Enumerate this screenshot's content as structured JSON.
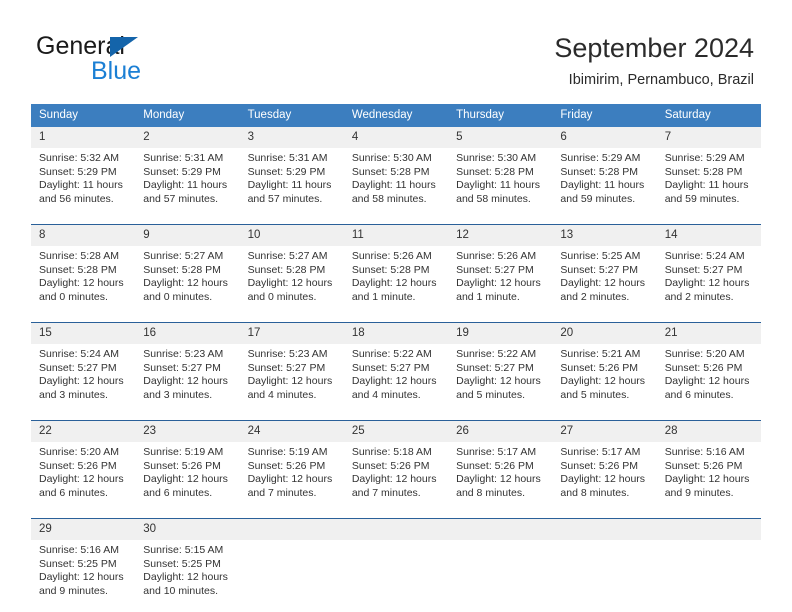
{
  "brand": {
    "name_top": "General",
    "name_bottom": "Blue",
    "triangle_color": "#1464aa",
    "blue_color": "#1b7fd4"
  },
  "header": {
    "title": "September 2024",
    "subtitle": "Ibimirim, Pernambuco, Brazil"
  },
  "theme": {
    "header_bg": "#3c7ebf",
    "header_text": "#ffffff",
    "daynum_bg": "#f0f0f0",
    "separator": "#2a6099",
    "body_text": "#333333"
  },
  "calendar": {
    "weekdays": [
      "Sunday",
      "Monday",
      "Tuesday",
      "Wednesday",
      "Thursday",
      "Friday",
      "Saturday"
    ],
    "weeks": [
      [
        {
          "day": "1",
          "sunrise": "Sunrise: 5:32 AM",
          "sunset": "Sunset: 5:29 PM",
          "daylight1": "Daylight: 11 hours",
          "daylight2": "and 56 minutes."
        },
        {
          "day": "2",
          "sunrise": "Sunrise: 5:31 AM",
          "sunset": "Sunset: 5:29 PM",
          "daylight1": "Daylight: 11 hours",
          "daylight2": "and 57 minutes."
        },
        {
          "day": "3",
          "sunrise": "Sunrise: 5:31 AM",
          "sunset": "Sunset: 5:29 PM",
          "daylight1": "Daylight: 11 hours",
          "daylight2": "and 57 minutes."
        },
        {
          "day": "4",
          "sunrise": "Sunrise: 5:30 AM",
          "sunset": "Sunset: 5:28 PM",
          "daylight1": "Daylight: 11 hours",
          "daylight2": "and 58 minutes."
        },
        {
          "day": "5",
          "sunrise": "Sunrise: 5:30 AM",
          "sunset": "Sunset: 5:28 PM",
          "daylight1": "Daylight: 11 hours",
          "daylight2": "and 58 minutes."
        },
        {
          "day": "6",
          "sunrise": "Sunrise: 5:29 AM",
          "sunset": "Sunset: 5:28 PM",
          "daylight1": "Daylight: 11 hours",
          "daylight2": "and 59 minutes."
        },
        {
          "day": "7",
          "sunrise": "Sunrise: 5:29 AM",
          "sunset": "Sunset: 5:28 PM",
          "daylight1": "Daylight: 11 hours",
          "daylight2": "and 59 minutes."
        }
      ],
      [
        {
          "day": "8",
          "sunrise": "Sunrise: 5:28 AM",
          "sunset": "Sunset: 5:28 PM",
          "daylight1": "Daylight: 12 hours",
          "daylight2": "and 0 minutes."
        },
        {
          "day": "9",
          "sunrise": "Sunrise: 5:27 AM",
          "sunset": "Sunset: 5:28 PM",
          "daylight1": "Daylight: 12 hours",
          "daylight2": "and 0 minutes."
        },
        {
          "day": "10",
          "sunrise": "Sunrise: 5:27 AM",
          "sunset": "Sunset: 5:28 PM",
          "daylight1": "Daylight: 12 hours",
          "daylight2": "and 0 minutes."
        },
        {
          "day": "11",
          "sunrise": "Sunrise: 5:26 AM",
          "sunset": "Sunset: 5:28 PM",
          "daylight1": "Daylight: 12 hours",
          "daylight2": "and 1 minute."
        },
        {
          "day": "12",
          "sunrise": "Sunrise: 5:26 AM",
          "sunset": "Sunset: 5:27 PM",
          "daylight1": "Daylight: 12 hours",
          "daylight2": "and 1 minute."
        },
        {
          "day": "13",
          "sunrise": "Sunrise: 5:25 AM",
          "sunset": "Sunset: 5:27 PM",
          "daylight1": "Daylight: 12 hours",
          "daylight2": "and 2 minutes."
        },
        {
          "day": "14",
          "sunrise": "Sunrise: 5:24 AM",
          "sunset": "Sunset: 5:27 PM",
          "daylight1": "Daylight: 12 hours",
          "daylight2": "and 2 minutes."
        }
      ],
      [
        {
          "day": "15",
          "sunrise": "Sunrise: 5:24 AM",
          "sunset": "Sunset: 5:27 PM",
          "daylight1": "Daylight: 12 hours",
          "daylight2": "and 3 minutes."
        },
        {
          "day": "16",
          "sunrise": "Sunrise: 5:23 AM",
          "sunset": "Sunset: 5:27 PM",
          "daylight1": "Daylight: 12 hours",
          "daylight2": "and 3 minutes."
        },
        {
          "day": "17",
          "sunrise": "Sunrise: 5:23 AM",
          "sunset": "Sunset: 5:27 PM",
          "daylight1": "Daylight: 12 hours",
          "daylight2": "and 4 minutes."
        },
        {
          "day": "18",
          "sunrise": "Sunrise: 5:22 AM",
          "sunset": "Sunset: 5:27 PM",
          "daylight1": "Daylight: 12 hours",
          "daylight2": "and 4 minutes."
        },
        {
          "day": "19",
          "sunrise": "Sunrise: 5:22 AM",
          "sunset": "Sunset: 5:27 PM",
          "daylight1": "Daylight: 12 hours",
          "daylight2": "and 5 minutes."
        },
        {
          "day": "20",
          "sunrise": "Sunrise: 5:21 AM",
          "sunset": "Sunset: 5:26 PM",
          "daylight1": "Daylight: 12 hours",
          "daylight2": "and 5 minutes."
        },
        {
          "day": "21",
          "sunrise": "Sunrise: 5:20 AM",
          "sunset": "Sunset: 5:26 PM",
          "daylight1": "Daylight: 12 hours",
          "daylight2": "and 6 minutes."
        }
      ],
      [
        {
          "day": "22",
          "sunrise": "Sunrise: 5:20 AM",
          "sunset": "Sunset: 5:26 PM",
          "daylight1": "Daylight: 12 hours",
          "daylight2": "and 6 minutes."
        },
        {
          "day": "23",
          "sunrise": "Sunrise: 5:19 AM",
          "sunset": "Sunset: 5:26 PM",
          "daylight1": "Daylight: 12 hours",
          "daylight2": "and 6 minutes."
        },
        {
          "day": "24",
          "sunrise": "Sunrise: 5:19 AM",
          "sunset": "Sunset: 5:26 PM",
          "daylight1": "Daylight: 12 hours",
          "daylight2": "and 7 minutes."
        },
        {
          "day": "25",
          "sunrise": "Sunrise: 5:18 AM",
          "sunset": "Sunset: 5:26 PM",
          "daylight1": "Daylight: 12 hours",
          "daylight2": "and 7 minutes."
        },
        {
          "day": "26",
          "sunrise": "Sunrise: 5:17 AM",
          "sunset": "Sunset: 5:26 PM",
          "daylight1": "Daylight: 12 hours",
          "daylight2": "and 8 minutes."
        },
        {
          "day": "27",
          "sunrise": "Sunrise: 5:17 AM",
          "sunset": "Sunset: 5:26 PM",
          "daylight1": "Daylight: 12 hours",
          "daylight2": "and 8 minutes."
        },
        {
          "day": "28",
          "sunrise": "Sunrise: 5:16 AM",
          "sunset": "Sunset: 5:26 PM",
          "daylight1": "Daylight: 12 hours",
          "daylight2": "and 9 minutes."
        }
      ],
      [
        {
          "day": "29",
          "sunrise": "Sunrise: 5:16 AM",
          "sunset": "Sunset: 5:25 PM",
          "daylight1": "Daylight: 12 hours",
          "daylight2": "and 9 minutes."
        },
        {
          "day": "30",
          "sunrise": "Sunrise: 5:15 AM",
          "sunset": "Sunset: 5:25 PM",
          "daylight1": "Daylight: 12 hours",
          "daylight2": "and 10 minutes."
        },
        {
          "day": "",
          "sunrise": "",
          "sunset": "",
          "daylight1": "",
          "daylight2": ""
        },
        {
          "day": "",
          "sunrise": "",
          "sunset": "",
          "daylight1": "",
          "daylight2": ""
        },
        {
          "day": "",
          "sunrise": "",
          "sunset": "",
          "daylight1": "",
          "daylight2": ""
        },
        {
          "day": "",
          "sunrise": "",
          "sunset": "",
          "daylight1": "",
          "daylight2": ""
        },
        {
          "day": "",
          "sunrise": "",
          "sunset": "",
          "daylight1": "",
          "daylight2": ""
        }
      ]
    ]
  }
}
